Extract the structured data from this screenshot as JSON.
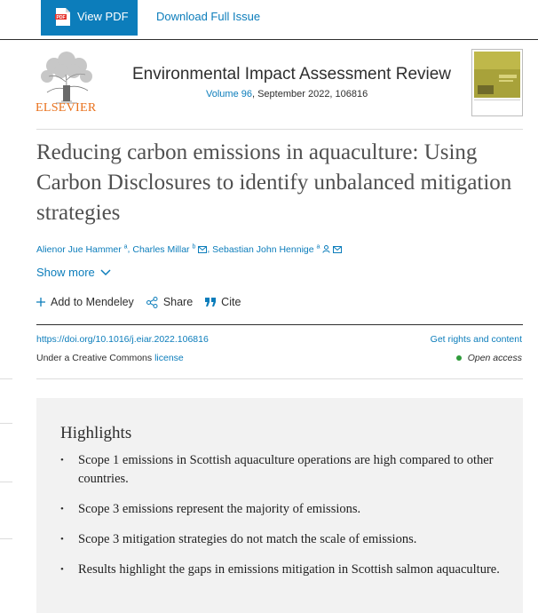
{
  "toolbar": {
    "view_pdf_label": "View PDF",
    "download_issue_label": "Download Full Issue"
  },
  "journal": {
    "publisher": "ELSEVIER",
    "name": "Environmental Impact Assessment Review",
    "volume_link": "Volume 96",
    "volume_rest": ", September 2022, 106816"
  },
  "article": {
    "title": "Reducing carbon emissions in aquaculture: Using Carbon Disclosures to identify unbalanced mitigation strategies",
    "authors": [
      {
        "name": "Alienor Jue Hammer",
        "affil": "a"
      },
      {
        "name": "Charles Millar",
        "affil": "b"
      },
      {
        "name": "Sebastian John Hennige",
        "affil": "a"
      }
    ],
    "show_more": "Show more"
  },
  "actions": {
    "mendeley": "Add to Mendeley",
    "share": "Share",
    "cite": "Cite"
  },
  "meta": {
    "doi": "https://doi.org/10.1016/j.eiar.2022.106816",
    "rights": "Get rights and content",
    "license_prefix": "Under a Creative Commons ",
    "license_link": "license",
    "open_access": "Open access"
  },
  "highlights": {
    "title": "Highlights",
    "items": [
      "Scope 1 emissions in Scottish aquaculture operations are high compared to other countries.",
      "Scope 3 emissions represent the majority of emissions.",
      "Scope 3 mitigation strategies do not match the scale of emissions.",
      "Results highlight the gaps in emissions mitigation in Scottish salmon aquaculture."
    ]
  },
  "colors": {
    "accent": "#0c7dbb",
    "publisher_orange": "#e9711c",
    "open_access_dot": "#2f9b3b",
    "highlights_bg": "#f2f2f2"
  },
  "icons": [
    "pdf-icon",
    "elsevier-tree-logo",
    "journal-cover",
    "chevron-down-icon",
    "plus-icon",
    "share-icon",
    "quote-icon",
    "person-icon",
    "envelope-icon"
  ]
}
